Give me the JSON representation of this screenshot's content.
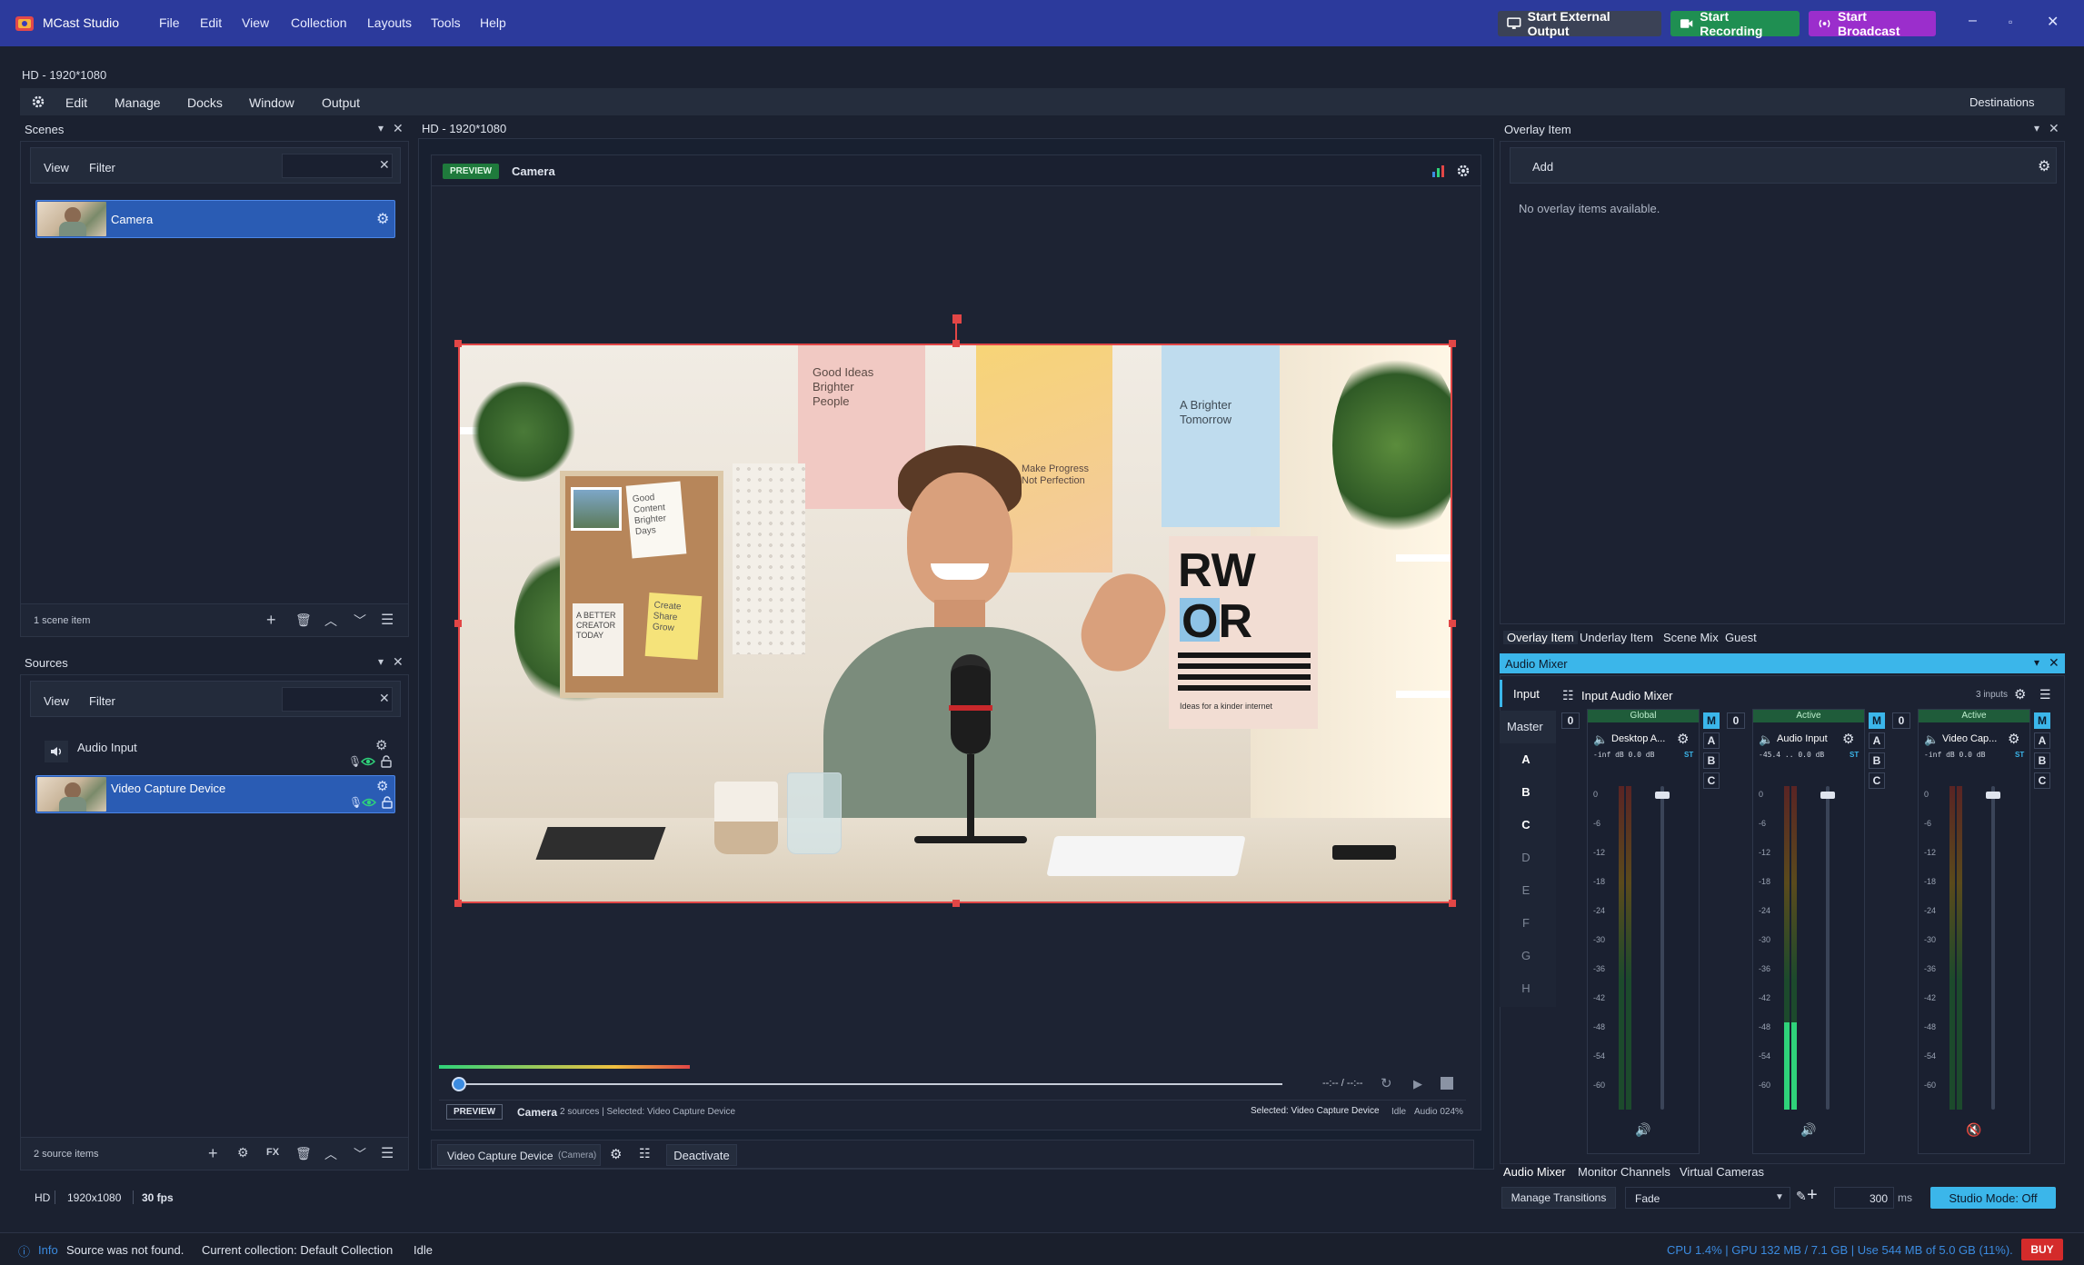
{
  "titlebar": {
    "app_name": "MCast Studio",
    "menus": [
      "File",
      "Edit",
      "View",
      "Collection",
      "Layouts",
      "Tools",
      "Help"
    ],
    "start_external_output": "Start External Output",
    "start_recording": "Start Recording",
    "start_broadcast": "Start Broadcast",
    "colors": {
      "bar": "#2c3a9c",
      "recording": "#1f8f52",
      "broadcast": "#9b2ecc",
      "external": "#3b4256"
    }
  },
  "workspace": {
    "tab_label": "HD - 1920*1080",
    "menu": [
      "Edit",
      "Manage",
      "Docks",
      "Window",
      "Output"
    ],
    "destinations": "Destinations"
  },
  "scenes": {
    "title": "Scenes",
    "view": "View",
    "filter": "Filter",
    "items": [
      {
        "label": "Camera"
      }
    ],
    "footer": "1 scene item"
  },
  "sources": {
    "title": "Sources",
    "view": "View",
    "filter": "Filter",
    "items": [
      {
        "label": "Audio Input"
      },
      {
        "label": "Video Capture Device"
      }
    ],
    "footer": "2 source items"
  },
  "preview": {
    "header": "HD - 1920*1080",
    "badge": "PREVIEW",
    "scene_name": "Camera",
    "timecode": "--:-- / --:--",
    "footer_badge": "PREVIEW",
    "footer_scene": "Camera",
    "footer_info": "2 sources | Selected: Video Capture Device",
    "selected_info": "Selected: Video Capture Device",
    "idle": "Idle",
    "audio": "Audio 024%",
    "poster_texts": {
      "good_ideas": "Good Ideas Brighter People",
      "make_progress": "Make Progress Not Perfection",
      "brighter_tomorrow": "A Brighter Tomorrow",
      "rw": "RW",
      "or": "OR",
      "kinder": "Ideas for a kinder internet",
      "note1": "Good Content Brighter Days",
      "note2": "Create Share Grow",
      "better": "A BETTER CREATOR TODAY"
    }
  },
  "source_bar": {
    "source": "Video Capture Device",
    "source_sub": "(Camera)",
    "deactivate": "Deactivate"
  },
  "overlay": {
    "title": "Overlay Item",
    "add": "Add",
    "empty": "No overlay items available.",
    "tabs": [
      "Overlay Item",
      "Underlay Item",
      "Scene Mix",
      "Guest"
    ]
  },
  "mixer": {
    "title": "Audio Mixer",
    "input_tab": "Input",
    "master_tab": "Master",
    "side_tabs": [
      "A",
      "B",
      "C",
      "D",
      "E",
      "F",
      "G",
      "H"
    ],
    "header": "Input Audio Mixer",
    "inputs_count": "3 inputs",
    "scale": [
      "0",
      "-6",
      "-12",
      "-18",
      "-24",
      "-30",
      "-36",
      "-42",
      "-48",
      "-54",
      "-60"
    ],
    "channels": [
      {
        "id": "0",
        "status": "Global",
        "name": "Desktop A...",
        "db": "-inf dB 0.0 dB",
        "st": "ST",
        "level": 0.0,
        "muted": false
      },
      {
        "id": "0",
        "status": "Active",
        "name": "Audio Input",
        "db": "-45.4 .. 0.0 dB",
        "st": "ST",
        "level": 0.27,
        "muted": false
      },
      {
        "id": "0",
        "status": "Active",
        "name": "Video Cap...",
        "db": "-inf dB 0.0 dB",
        "st": "ST",
        "level": 0.0,
        "muted": true
      }
    ],
    "bottom_tabs": [
      "Audio Mixer",
      "Monitor Channels",
      "Virtual Cameras"
    ]
  },
  "bottombar": {
    "hd": "HD",
    "resolution": "1920x1080",
    "fps": "30 fps",
    "manage_transitions": "Manage Transitions",
    "transition": "Fade",
    "duration": "300",
    "duration_unit": "ms",
    "studio_mode": "Studio Mode: Off"
  },
  "statusbar": {
    "info": "Info",
    "message": "Source was not found.",
    "collection": "Current collection: Default Collection",
    "state": "Idle",
    "stats": "CPU 1.4% | GPU 132 MB / 7.1 GB | Use 544 MB of 5.0 GB (11%).",
    "buy": "BUY"
  }
}
